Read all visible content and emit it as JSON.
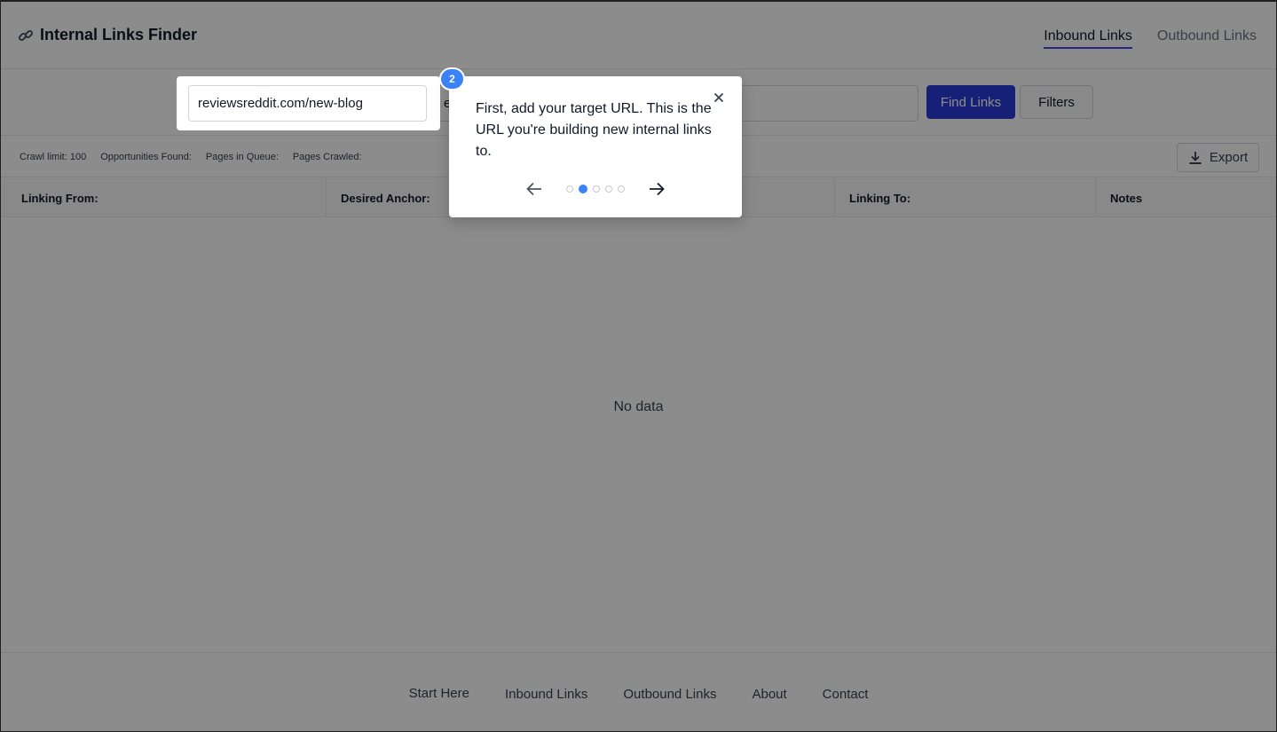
{
  "app": {
    "title": "Internal Links Finder"
  },
  "nav": {
    "inbound": "Inbound Links",
    "outbound": "Outbound Links"
  },
  "inputs": {
    "target_url": "reviewsreddit.com/new-blog",
    "anchor_prefix": "e"
  },
  "buttons": {
    "find": "Find Links",
    "filters": "Filters",
    "export": "Export"
  },
  "stats": {
    "crawl_limit": "Crawl limit: 100",
    "opportunities": "Opportunities Found:",
    "queue": "Pages in Queue:",
    "crawled": "Pages Crawled:"
  },
  "table": {
    "columns": [
      "Linking From:",
      "Desired Anchor:",
      "",
      "Linking To:",
      "Notes"
    ],
    "empty": "No data"
  },
  "footer": {
    "links": [
      "Start Here",
      "Inbound Links",
      "Outbound Links",
      "About",
      "Contact"
    ]
  },
  "tour": {
    "step": "2",
    "text": "First, add your target URL. This is the URL you're building new internal links to.",
    "total_steps": 5,
    "current_step": 2
  },
  "colors": {
    "primary": "#2b3bd9",
    "accent": "#3b82f6",
    "underline": "#4f46e5"
  },
  "icons": {
    "logo": "link-icon",
    "export": "download-icon",
    "close": "close-icon",
    "prev": "arrow-left-icon",
    "next": "arrow-right-icon"
  }
}
